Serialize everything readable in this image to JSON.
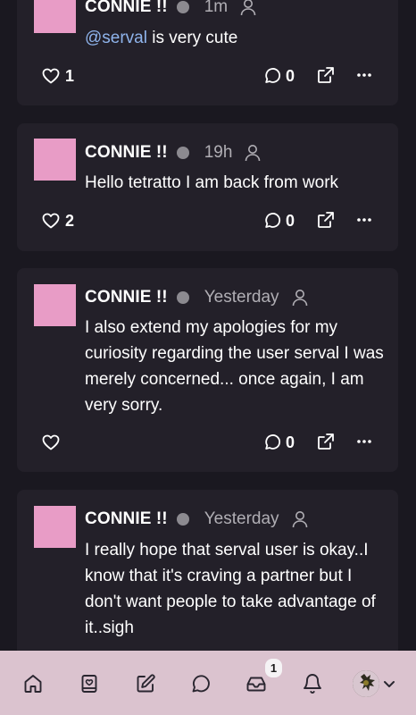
{
  "posts": [
    {
      "author": "CONNIE !!",
      "time": "1m",
      "mention": "@serval",
      "text": " is very cute",
      "likes": "1",
      "replies": "0"
    },
    {
      "author": "CONNIE !!",
      "time": "19h",
      "mention": "",
      "text": "Hello tetratto I am back from work",
      "likes": "2",
      "replies": "0"
    },
    {
      "author": "CONNIE !!",
      "time": "Yesterday",
      "mention": "",
      "text": "I also extend my apologies for my curiosity regarding the user serval I was merely concerned... once again, I am very sorry.",
      "likes": "",
      "replies": "0"
    },
    {
      "author": "CONNIE !!",
      "time": "Yesterday",
      "mention": "",
      "text": "I really hope that serval user is okay..I know that it's craving a partner but I don't want people to take advantage of it..sigh",
      "likes": "",
      "replies": ""
    }
  ],
  "nav": {
    "items": [
      "home-icon",
      "book-icon",
      "compose-icon",
      "chat-icon",
      "inbox-icon",
      "bell-icon"
    ],
    "inbox_badge": "1"
  },
  "colors": {
    "background": "#1a1820",
    "card": "#232029",
    "avatar": "#e89cc6",
    "mention": "#8fb4ec",
    "nav_bar": "#dbc3cf"
  }
}
